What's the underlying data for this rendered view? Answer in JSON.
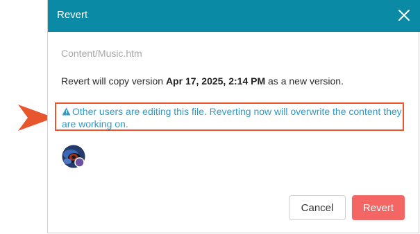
{
  "dialog": {
    "title": "Revert",
    "close_icon": "close-icon",
    "file_path": "Content/Music.htm",
    "message_prefix": "Revert will copy version ",
    "version_label": "Apr 17, 2025, 2:14 PM",
    "message_suffix": " as a new version.",
    "warning_icon": "warning-icon",
    "warning_text": "Other users are editing this file. Reverting now will overwrite the content they are working on.",
    "avatar_icon": "user-avatar",
    "cancel_label": "Cancel",
    "revert_label": "Revert"
  },
  "callout": {
    "icon": "callout-arrow-icon"
  },
  "colors": {
    "header": "#0b8aa6",
    "warning_text": "#2e9bc4",
    "callout": "#e8562e",
    "revert_button": "#f46664",
    "path_text": "#a7a7a7"
  }
}
